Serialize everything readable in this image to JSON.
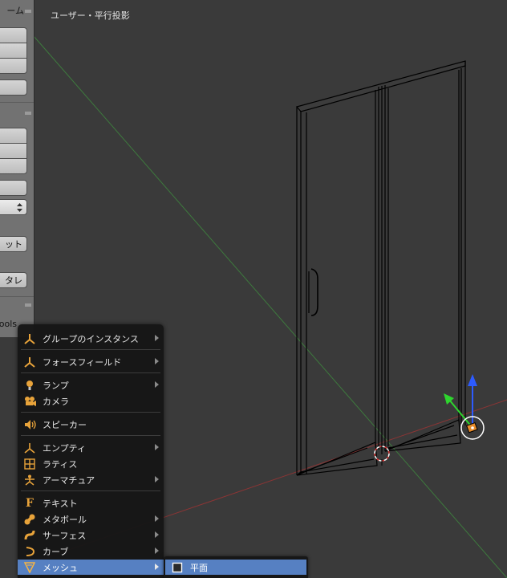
{
  "viewport": {
    "title": "ユーザー・平行投影"
  },
  "toolshelf": {
    "panel1_title": "ーム",
    "panel3_title": "ools",
    "btn_set": "ット",
    "btn_del": "タレ",
    "dropdown_icon": "up-down-arrows-icon"
  },
  "add_menu": {
    "items": [
      {
        "label": "グループのインスタンス",
        "icon": "group-instance-icon",
        "submenu": true
      },
      {
        "label": "フォースフィールド",
        "icon": "force-field-icon",
        "submenu": true
      },
      {
        "label": "ランプ",
        "icon": "lamp-icon",
        "submenu": true
      },
      {
        "label": "カメラ",
        "icon": "camera-icon",
        "submenu": false
      },
      {
        "label": "スピーカー",
        "icon": "speaker-icon",
        "submenu": false
      },
      {
        "label": "エンプティ",
        "icon": "empty-icon",
        "submenu": true
      },
      {
        "label": "ラティス",
        "icon": "lattice-icon",
        "submenu": false
      },
      {
        "label": "アーマチュア",
        "icon": "armature-icon",
        "submenu": true
      },
      {
        "label": "テキスト",
        "icon": "text-icon",
        "submenu": false
      },
      {
        "label": "メタボール",
        "icon": "metaball-icon",
        "submenu": true
      },
      {
        "label": "サーフェス",
        "icon": "surface-icon",
        "submenu": true
      },
      {
        "label": "カーブ",
        "icon": "curve-icon",
        "submenu": true
      },
      {
        "label": "メッシュ",
        "icon": "mesh-icon",
        "submenu": true,
        "active": true
      }
    ],
    "submenu_mesh": {
      "items": [
        {
          "label": "平面",
          "icon": "plane-icon"
        }
      ]
    }
  },
  "colors": {
    "accent_orange": "#e8a33a",
    "menu_highlight": "#5680c2",
    "axis_x": "#a33a3a",
    "axis_y": "#3f8f3f",
    "gizmo_z": "#2d5bff",
    "gizmo_y": "#2ed52e"
  }
}
